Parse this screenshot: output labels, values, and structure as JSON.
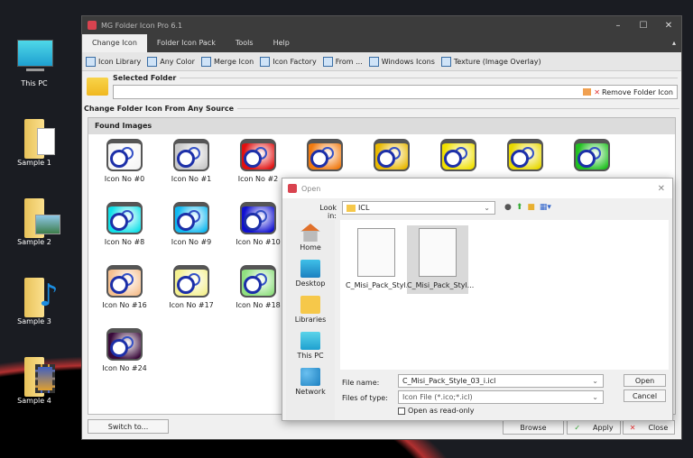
{
  "desktop": [
    {
      "label": "This PC"
    },
    {
      "label": "Sample 1"
    },
    {
      "label": "Sample 2"
    },
    {
      "label": "Sample 3"
    },
    {
      "label": "Sample 4"
    }
  ],
  "app": {
    "title": "MG Folder Icon Pro 6.1",
    "tabs": [
      {
        "label": "Change Icon"
      },
      {
        "label": "Folder Icon Pack"
      },
      {
        "label": "Tools"
      },
      {
        "label": "Help"
      }
    ],
    "toolbar": [
      {
        "label": "Icon Library"
      },
      {
        "label": "Any Color"
      },
      {
        "label": "Merge Icon"
      },
      {
        "label": "Icon Factory"
      },
      {
        "label": "From ..."
      },
      {
        "label": "Windows Icons"
      },
      {
        "label": "Texture (Image Overlay)"
      }
    ],
    "selected_folder_label": "Selected Folder",
    "selected_folder_value": "",
    "remove_label": "Remove Folder Icon",
    "section_label": "Change Folder Icon From Any Source",
    "found_label": "Found Images",
    "icons": [
      {
        "label": "Icon No #0",
        "color": "#f4f4f4"
      },
      {
        "label": "Icon No #1",
        "color": "#c8c8c8"
      },
      {
        "label": "Icon No #2",
        "color": "#e01010"
      },
      {
        "label": "",
        "color": "#f07a10"
      },
      {
        "label": "",
        "color": "#e8b800"
      },
      {
        "label": "",
        "color": "#f0e000"
      },
      {
        "label": "",
        "color": "#e8d800"
      },
      {
        "label": "",
        "color": "#20c020"
      },
      {
        "label": "Icon No #8",
        "color": "#10e0e8"
      },
      {
        "label": "Icon No #9",
        "color": "#10b8f0"
      },
      {
        "label": "Icon No #10",
        "color": "#1010d0"
      },
      {
        "label": "Icon No #16",
        "color": "#f5c090"
      },
      {
        "label": "Icon No #17",
        "color": "#f4f090"
      },
      {
        "label": "Icon No #18",
        "color": "#90e080"
      },
      {
        "label": "Icon No #24",
        "color": "#3a0a3a"
      }
    ],
    "switch_label": "Switch to...",
    "browse_label": "Browse",
    "apply_label": "Apply",
    "close_label": "Close"
  },
  "dialog": {
    "title": "Open",
    "look_in_label": "Look in:",
    "look_in_value": "ICL",
    "places": [
      {
        "label": "Home"
      },
      {
        "label": "Desktop"
      },
      {
        "label": "Libraries"
      },
      {
        "label": "This PC"
      },
      {
        "label": "Network"
      }
    ],
    "files": [
      {
        "label": "C_Misi_Pack_Styl..."
      },
      {
        "label": "C_Misi_Pack_Styl..."
      }
    ],
    "file_name_label": "File name:",
    "file_name_value": "C_Misi_Pack_Style_03_i.icl",
    "file_type_label": "Files of type:",
    "file_type_value": "Icon File (*.ico;*.icl)",
    "readonly_label": "Open as read-only",
    "open_label": "Open",
    "cancel_label": "Cancel"
  }
}
